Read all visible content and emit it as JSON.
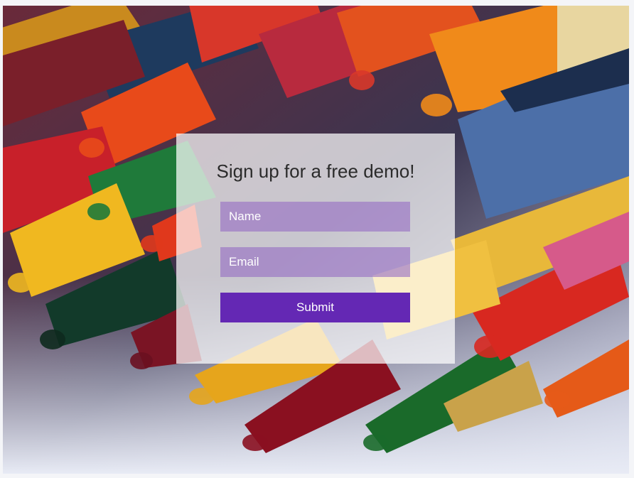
{
  "form": {
    "title": "Sign up for a free demo!",
    "name_placeholder": "Name",
    "email_placeholder": "Email",
    "submit_label": "Submit"
  },
  "colors": {
    "submit_button": "#6428b4",
    "input_fill": "#966ec3"
  }
}
